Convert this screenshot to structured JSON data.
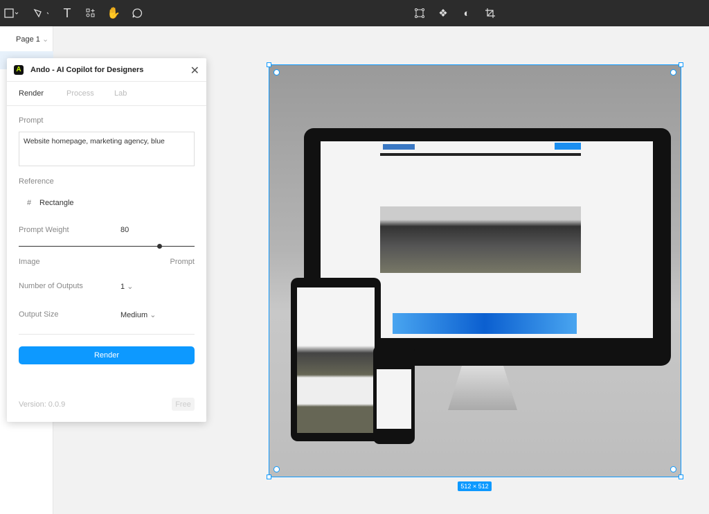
{
  "toolbar": {
    "left_tools": [
      "frame-icon",
      "pen-icon",
      "text-icon",
      "components-icon",
      "hand-icon",
      "comment-icon"
    ],
    "center_tools": [
      "bounding-box-icon",
      "component-icon",
      "contrast-icon",
      "crop-icon"
    ]
  },
  "sidebar": {
    "page_label": "Page 1"
  },
  "plugin": {
    "title": "Ando - AI Copilot for Designers",
    "tabs": [
      "Render",
      "Process",
      "Lab"
    ],
    "active_tab": "Render",
    "prompt_label": "Prompt",
    "prompt_value": "Website homepage, marketing agency, blue",
    "reference_label": "Reference",
    "reference_value": "Rectangle",
    "weight_label": "Prompt Weight",
    "weight_value": "80",
    "weight_percent": 80,
    "slider_left": "Image",
    "slider_right": "Prompt",
    "outputs_label": "Number of Outputs",
    "outputs_value": "1",
    "size_label": "Output Size",
    "size_value": "Medium",
    "render_button": "Render",
    "version": "Version: 0.0.9",
    "plan_badge": "Free"
  },
  "canvas": {
    "selection_size": "512 × 512"
  },
  "colors": {
    "accent": "#0d99ff",
    "toolbar": "#2c2c2c"
  }
}
